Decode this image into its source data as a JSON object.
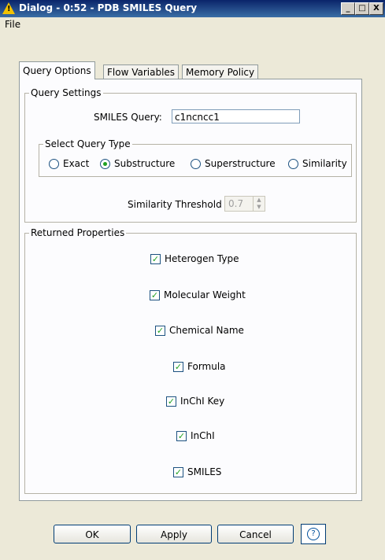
{
  "window": {
    "title": "Dialog - 0:52 - PDB SMILES Query",
    "minimize": "_",
    "maximize": "□",
    "close": "X"
  },
  "menu": {
    "file": "File"
  },
  "tabs": [
    {
      "label": "Query Options",
      "active": true
    },
    {
      "label": "Flow Variables",
      "active": false
    },
    {
      "label": "Memory Policy",
      "active": false
    }
  ],
  "query_settings": {
    "title": "Query Settings",
    "smiles_label": "SMILES Query:",
    "smiles_value": "c1ncncc1",
    "query_type": {
      "title": "Select Query Type",
      "options": [
        "Exact",
        "Substructure",
        "Superstructure",
        "Similarity"
      ],
      "selected": "Substructure"
    },
    "threshold_label": "Similarity Threshold",
    "threshold_value": "0.7"
  },
  "returned_properties": {
    "title": "Returned Properties",
    "items": [
      {
        "label": "Heterogen Type",
        "checked": true
      },
      {
        "label": "Molecular Weight",
        "checked": true
      },
      {
        "label": "Chemical Name",
        "checked": true
      },
      {
        "label": "Formula",
        "checked": true
      },
      {
        "label": "InChI Key",
        "checked": true
      },
      {
        "label": "InChI",
        "checked": true
      },
      {
        "label": "SMILES",
        "checked": true
      }
    ]
  },
  "buttons": {
    "ok": "OK",
    "apply": "Apply",
    "cancel": "Cancel",
    "help": "?"
  },
  "colors": {
    "titlebar": "#0a246a",
    "dialog_bg": "#ece9d8",
    "panel_bg": "#fcfcfe",
    "check_mark": "#21a121"
  }
}
